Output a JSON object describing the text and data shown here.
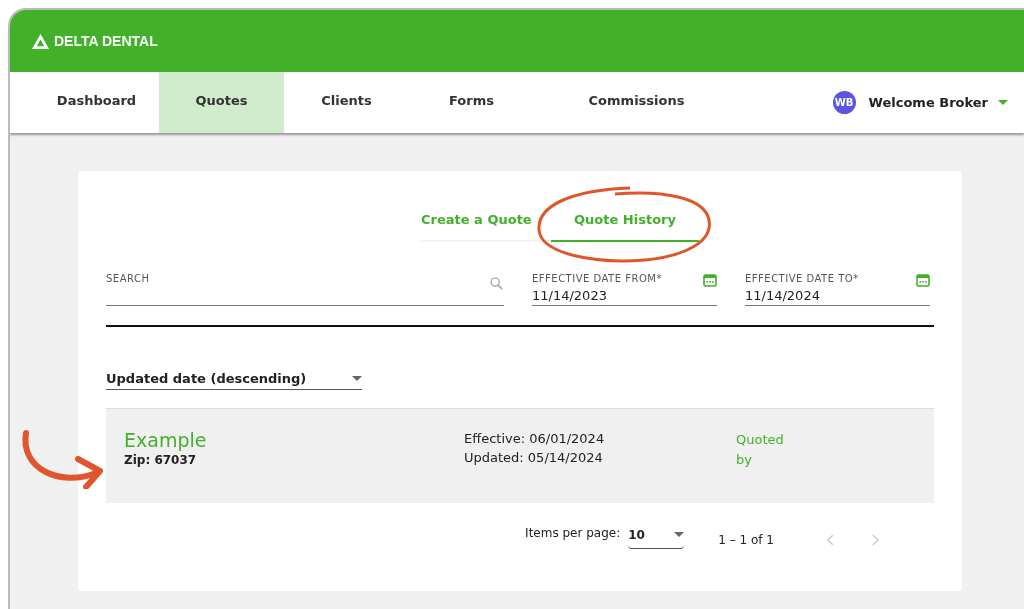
{
  "header": {
    "logo": "DELTA DENTAL"
  },
  "nav": {
    "items": [
      {
        "label": "Dashboard",
        "selected": false
      },
      {
        "label": "Quotes",
        "selected": true
      },
      {
        "label": "Clients",
        "selected": false
      },
      {
        "label": "Forms",
        "selected": false
      },
      {
        "label": "Commissions",
        "selected": false
      }
    ],
    "user": {
      "initials": "WB",
      "name": "Welcome Broker"
    }
  },
  "tabs": [
    {
      "label": "Create a Quote",
      "selected": false
    },
    {
      "label": "Quote History",
      "selected": true
    }
  ],
  "filters": {
    "search": {
      "label": "SEARCH"
    },
    "date_from": {
      "label": "EFFECTIVE DATE FROM*",
      "value": "11/14/2023"
    },
    "date_to": {
      "label": "EFFECTIVE DATE TO*",
      "value": "11/14/2024"
    }
  },
  "sort": {
    "value": "Updated date (descending)"
  },
  "quotes": [
    {
      "name": "Example",
      "zip": "Zip: 67037",
      "effective": "Effective: 06/01/2024",
      "updated": "Updated: 05/14/2024",
      "quoted_by": "Quoted by"
    }
  ],
  "pagination": {
    "label": "Items per page:",
    "page_size": "10",
    "range": "1 – 1 of 1"
  }
}
